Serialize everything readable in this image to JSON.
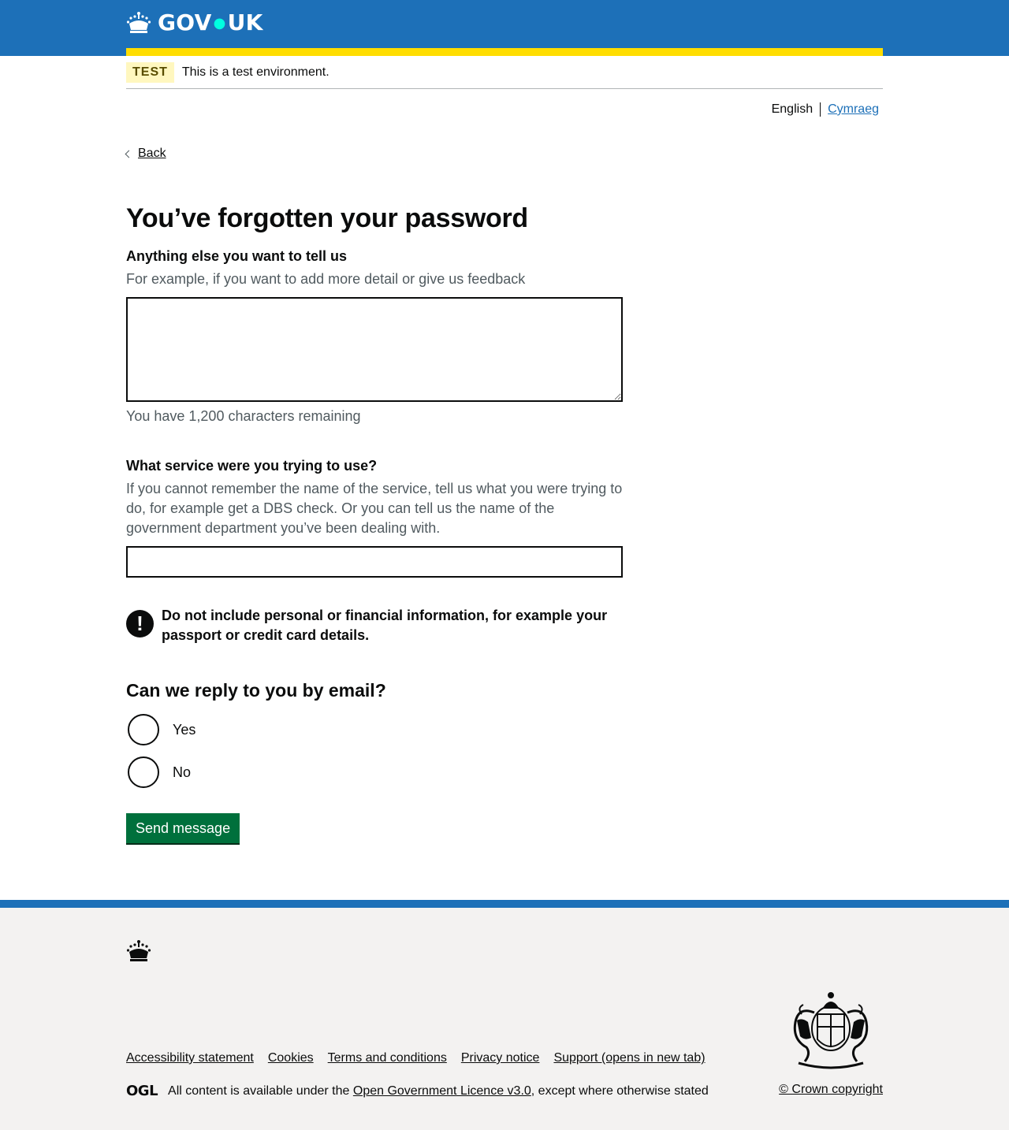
{
  "header": {
    "logo_text": "GOV",
    "logo_text_2": "UK",
    "colors": {
      "brand": "#1d70b8",
      "stripe": "#ffdd00"
    }
  },
  "phase_banner": {
    "tag": "TEST",
    "text": "This is a test environment."
  },
  "language": {
    "current": "English",
    "alternate": "Cymraeg"
  },
  "back_link": "Back",
  "page": {
    "title": "You’ve forgotten your password",
    "more_details": {
      "label": "Anything else you want to tell us",
      "hint": "For example, if you want to add more detail or give us feedback",
      "value": "",
      "count_message": "You have 1,200 characters remaining"
    },
    "service": {
      "label": "What service were you trying to use?",
      "hint": "If you cannot remember the name of the service, tell us what you were trying to do, for example get a DBS check. Or you can tell us the name of the government department you’ve been dealing with.",
      "value": ""
    },
    "warning": {
      "icon": "!",
      "text": "Do not include personal or financial information, for example your passport or credit card details."
    },
    "reply": {
      "legend": "Can we reply to you by email?",
      "options": [
        {
          "label": "Yes",
          "selected": false
        },
        {
          "label": "No",
          "selected": false
        }
      ]
    },
    "submit_label": "Send message",
    "colors": {
      "button": "#00703c"
    }
  },
  "footer": {
    "links": [
      "Accessibility statement",
      "Cookies",
      "Terms and conditions",
      "Privacy notice",
      "Support (opens in new tab)"
    ],
    "ogl_logo": "OGL",
    "licence_prefix": "All content is available under the",
    "licence_link": "Open Government Licence v3.0",
    "licence_suffix": ", except where otherwise stated",
    "copyright": "© Crown copyright"
  }
}
